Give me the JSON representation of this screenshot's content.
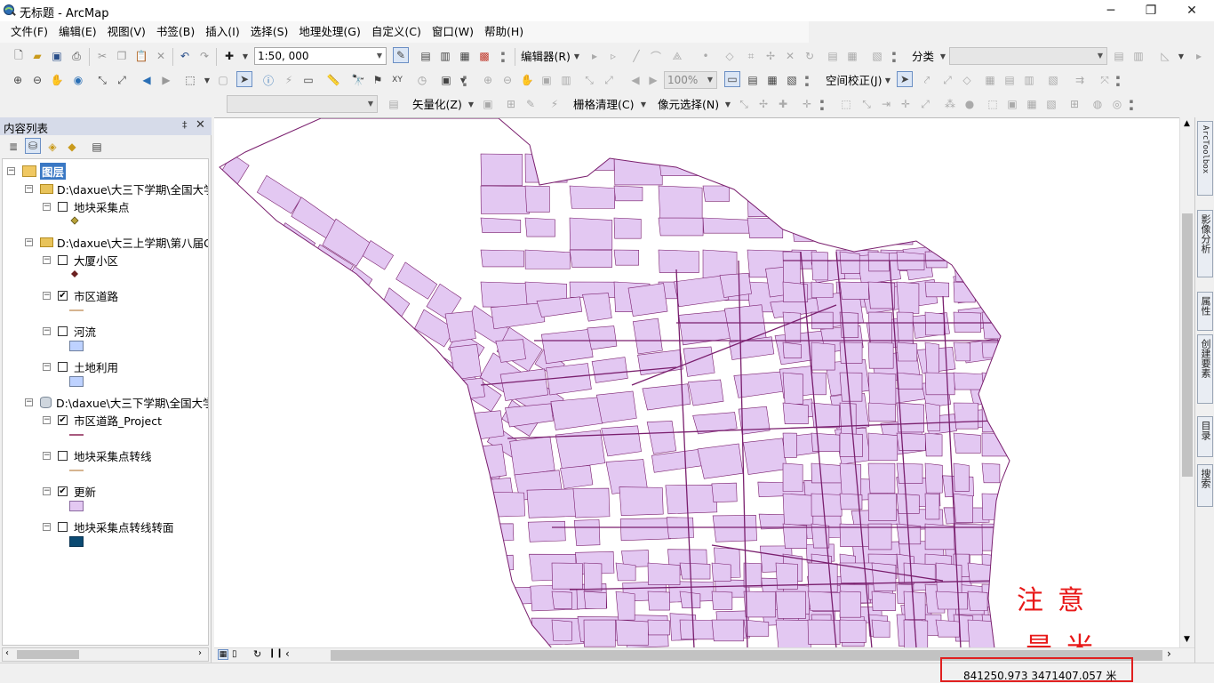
{
  "window": {
    "title": "无标题 - ArcMap",
    "controls": {
      "minimize": "─",
      "maximize": "❐",
      "close": "✕"
    }
  },
  "menu": [
    "文件(F)",
    "编辑(E)",
    "视图(V)",
    "书签(B)",
    "插入(I)",
    "选择(S)",
    "地理处理(G)",
    "自定义(C)",
    "窗口(W)",
    "帮助(H)"
  ],
  "toolbar": {
    "scale": "1:50, 000",
    "editor_label": "编辑器(R)",
    "classify_label": "分类",
    "zoom_percent": "100%",
    "georef_label": "空间校正(J)",
    "vectorize_label": "矢量化(Z)",
    "raster_cleanup_label": "栅格清理(C)",
    "pixel_select_label": "像元选择(N)"
  },
  "toc": {
    "title": "内容列表",
    "pin": "‡",
    "close": "✕",
    "root_label": "图层",
    "items": [
      {
        "label": "D:\\daxue\\大三下学期\\全国大学",
        "kind": "folder",
        "level": 1
      },
      {
        "label": "地块采集点",
        "kind": "layer",
        "checked": false,
        "level": 2,
        "symbol": "point",
        "symbol_color": "#b8a23a"
      },
      {
        "label": "D:\\daxue\\大三上学期\\第八届G",
        "kind": "folder",
        "level": 1
      },
      {
        "label": "大厦小区",
        "kind": "layer",
        "checked": false,
        "level": 2,
        "symbol": "point",
        "symbol_color": "#6b2020"
      },
      {
        "label": "市区道路",
        "kind": "layer",
        "checked": true,
        "level": 2,
        "symbol": "line",
        "symbol_color": "#c89a6a"
      },
      {
        "label": "河流",
        "kind": "layer",
        "checked": false,
        "level": 2,
        "symbol": "fill",
        "symbol_color": "#bed2ff"
      },
      {
        "label": "土地利用",
        "kind": "layer",
        "checked": false,
        "level": 2,
        "symbol": "fill",
        "symbol_color": "#bed2ff"
      },
      {
        "label": "D:\\daxue\\大三下学期\\全国大学",
        "kind": "database",
        "level": 1
      },
      {
        "label": "市区道路_Project",
        "kind": "layer",
        "checked": true,
        "level": 2,
        "symbol": "line",
        "symbol_color": "#8b2252"
      },
      {
        "label": "地块采集点转线",
        "kind": "layer",
        "checked": false,
        "level": 2,
        "symbol": "line",
        "symbol_color": "#c89a6a"
      },
      {
        "label": "更新",
        "kind": "layer",
        "checked": true,
        "level": 2,
        "symbol": "fill",
        "symbol_color": "#e3c8f2"
      },
      {
        "label": "地块采集点转线转面",
        "kind": "layer",
        "checked": false,
        "level": 2,
        "symbol": "fill",
        "symbol_color": "#0b4a72"
      }
    ]
  },
  "right_dock": [
    "ArcToolbox",
    "影像分析",
    "属性",
    "创建要素",
    "目录",
    "搜索"
  ],
  "status": {
    "coordinates": "841250.973  3471407.057 米"
  },
  "annotation": {
    "line1": "注意",
    "line2": "是米"
  },
  "colors": {
    "parcel_fill": "#e3c8f2",
    "parcel_outline": "#7a1f6e",
    "annotation": "#e81818"
  }
}
